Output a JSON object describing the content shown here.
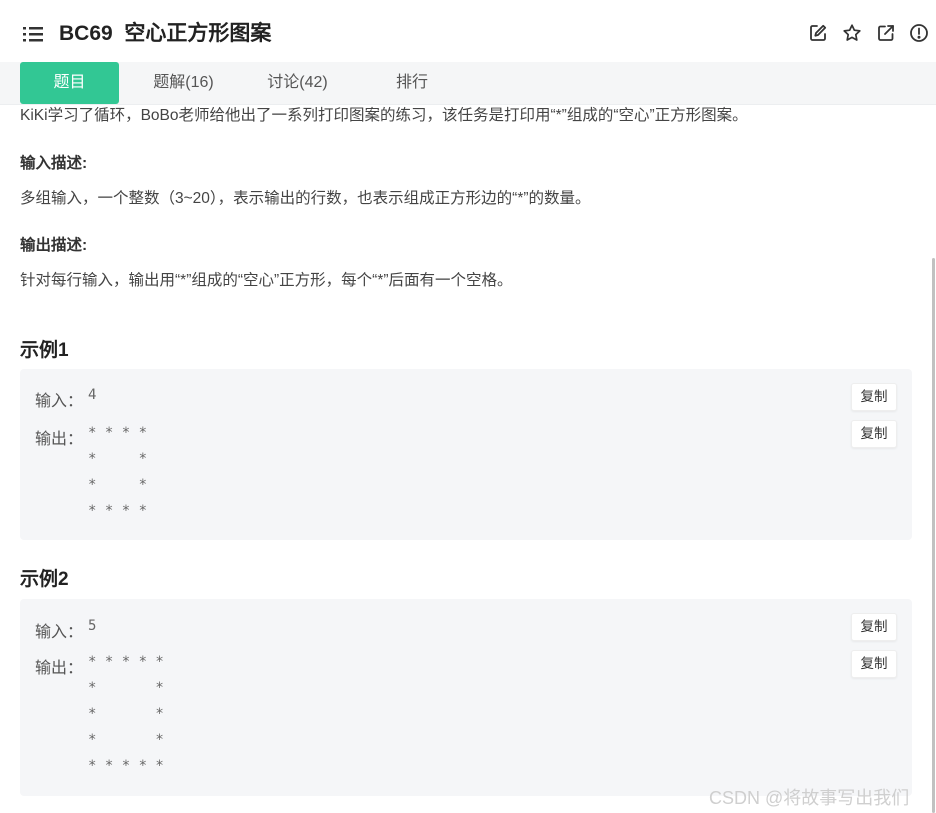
{
  "header": {
    "title": "BC69  空心正方形图案"
  },
  "tabs": [
    {
      "label": "题目",
      "active": true
    },
    {
      "label": "题解(16)",
      "active": false
    },
    {
      "label": "讨论(42)",
      "active": false
    },
    {
      "label": "排行",
      "active": false
    }
  ],
  "description_cut": "KiKi学习了循环，BoBo老师给他出了一系列打印图案的练习，该任务是打印用“*”组成的“空心”正方形图案。",
  "input_desc": {
    "label": "输入描述:",
    "text": "多组输入，一个整数（3~20），表示输出的行数，也表示组成正方形边的“*”的数量。"
  },
  "output_desc": {
    "label": "输出描述:",
    "text": "针对每行输入，输出用“*”组成的“空心”正方形，每个“*”后面有一个空格。"
  },
  "examples": [
    {
      "title": "示例1",
      "input_label": "输入：",
      "input": "4",
      "output_label": "输出：",
      "output": "* * * *\n*     *\n*     *\n* * * *",
      "copy_label": "复制"
    },
    {
      "title": "示例2",
      "input_label": "输入：",
      "input": "5",
      "output_label": "输出：",
      "output": "* * * * *\n*       *\n*       *\n*       *\n* * * * *",
      "copy_label": "复制"
    }
  ],
  "watermark": "CSDN @将故事写出我们",
  "colors": {
    "accent": "#32c794",
    "tab_bar_bg": "#f5f6f7",
    "example_bg": "#f5f6f8"
  },
  "icons": [
    "list-icon",
    "edit-icon",
    "star-icon",
    "external-link-icon",
    "info-icon"
  ]
}
